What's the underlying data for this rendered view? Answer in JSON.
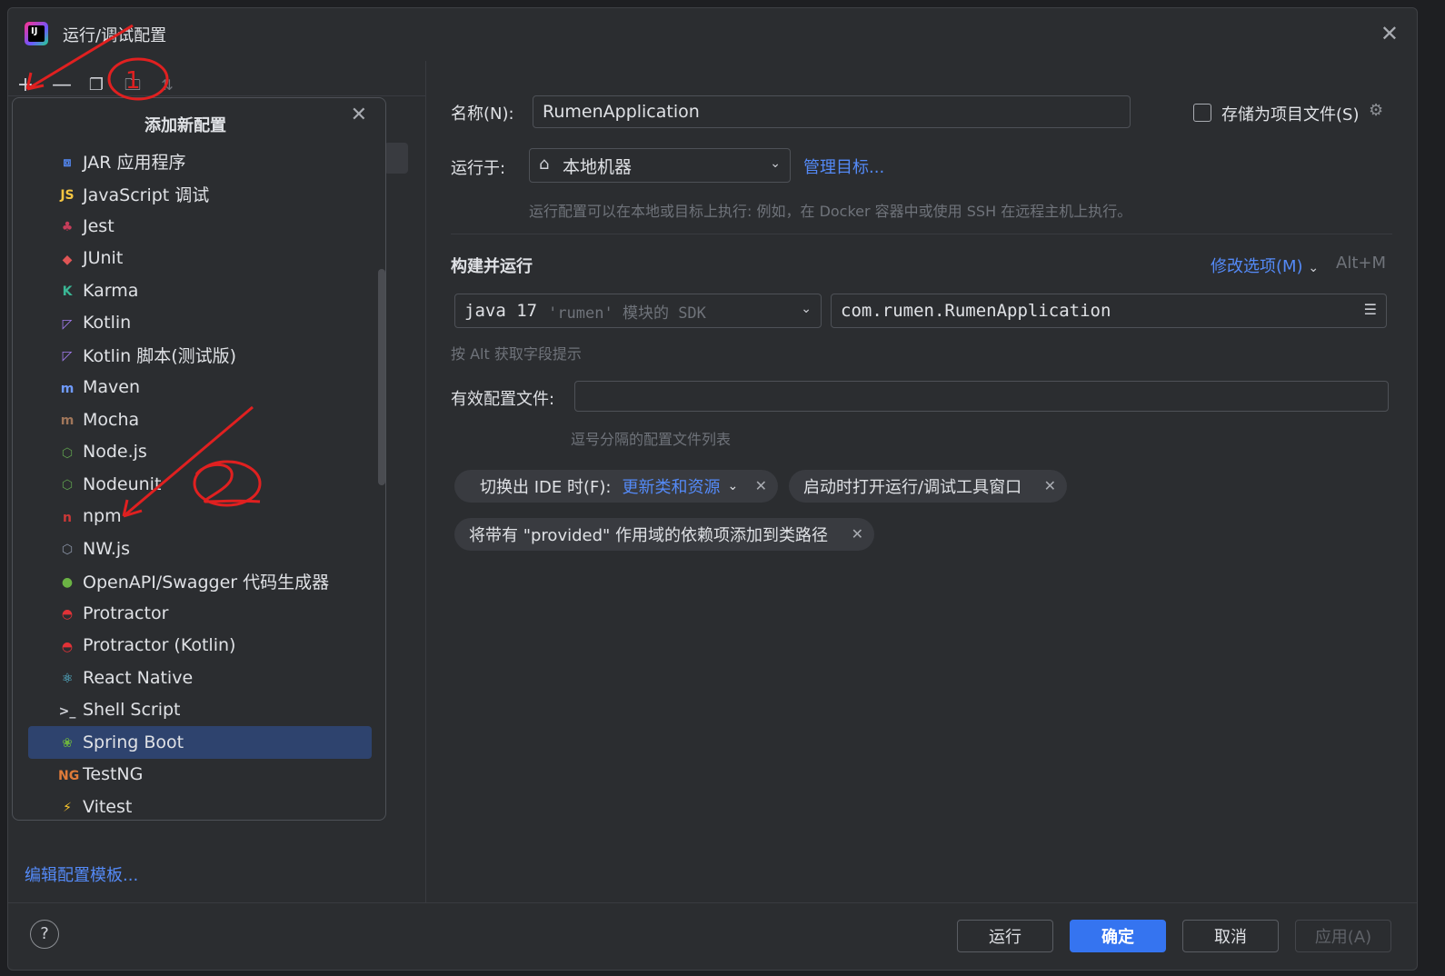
{
  "window": {
    "title": "运行/调试配置"
  },
  "toolbar": {
    "add": "+",
    "remove": "—"
  },
  "popup": {
    "title": "添加新配置",
    "items": [
      {
        "label": "JAR 应用程序",
        "icon": "jar-icon",
        "glyph": "⧈",
        "color": "#548af7"
      },
      {
        "label": "JavaScript 调试",
        "icon": "javascript-icon",
        "glyph": "JS",
        "color": "#f4c542"
      },
      {
        "label": "Jest",
        "icon": "jest-icon",
        "glyph": "♣",
        "color": "#c63d5a"
      },
      {
        "label": "JUnit",
        "icon": "junit-icon",
        "glyph": "◆",
        "color": "#e05555"
      },
      {
        "label": "Karma",
        "icon": "karma-icon",
        "glyph": "K",
        "color": "#3ab795"
      },
      {
        "label": "Kotlin",
        "icon": "kotlin-icon",
        "glyph": "◸",
        "color": "#a37cf0"
      },
      {
        "label": "Kotlin 脚本(测试版)",
        "icon": "kotlin-script-icon",
        "glyph": "◸",
        "color": "#a37cf0"
      },
      {
        "label": "Maven",
        "icon": "maven-icon",
        "glyph": "m",
        "color": "#6f9bff"
      },
      {
        "label": "Mocha",
        "icon": "mocha-icon",
        "glyph": "m",
        "color": "#a0765a"
      },
      {
        "label": "Node.js",
        "icon": "nodejs-icon",
        "glyph": "⬡",
        "color": "#5fa04e"
      },
      {
        "label": "Nodeunit",
        "icon": "nodeunit-icon",
        "glyph": "⬡",
        "color": "#5fa04e"
      },
      {
        "label": "npm",
        "icon": "npm-icon",
        "glyph": "n",
        "color": "#cb3837"
      },
      {
        "label": "NW.js",
        "icon": "nwjs-icon",
        "glyph": "⬡",
        "color": "#8c95a8"
      },
      {
        "label": "OpenAPI/Swagger 代码生成器",
        "icon": "openapi-icon",
        "glyph": "●",
        "color": "#6bb344"
      },
      {
        "label": "Protractor",
        "icon": "protractor-icon",
        "glyph": "◓",
        "color": "#e23237"
      },
      {
        "label": "Protractor (Kotlin)",
        "icon": "protractor-kotlin-icon",
        "glyph": "◓",
        "color": "#e23237"
      },
      {
        "label": "React Native",
        "icon": "react-icon",
        "glyph": "⚛",
        "color": "#61dafb"
      },
      {
        "label": "Shell Script",
        "icon": "shell-script-icon",
        "glyph": ">_",
        "color": "#ced0d6"
      },
      {
        "label": "Spring Boot",
        "icon": "spring-boot-icon",
        "glyph": "❀",
        "color": "#6db33f",
        "selected": true
      },
      {
        "label": "TestNG",
        "icon": "testng-icon",
        "glyph": "NG",
        "color": "#e07b39"
      },
      {
        "label": "Vitest",
        "icon": "vitest-icon",
        "glyph": "⚡",
        "color": "#fcc72b"
      }
    ]
  },
  "left": {
    "edit_templates": "编辑配置模板..."
  },
  "form": {
    "name_label": "名称(N):",
    "name_value": "RumenApplication",
    "store_label": "存储为项目文件(S)",
    "run_on_label": "运行于:",
    "run_on_value": "本地机器",
    "manage_targets": "管理目标...",
    "run_on_hint": "运行配置可以在本地或目标上执行: 例如，在 Docker 容器中或使用 SSH 在远程主机上执行。",
    "build_section": "构建并运行",
    "modify_options": "修改选项(M)",
    "modify_shortcut": "Alt+M",
    "jdk_value": "java 17",
    "jdk_hint": "'rumen' 模块的 SDK",
    "main_class": "com.rumen.RumenApplication",
    "alt_hint": "按 Alt 获取字段提示",
    "active_profiles_label": "有效配置文件:",
    "active_profiles_hint": "逗号分隔的配置文件列表",
    "chip1_label": "切换出 IDE 时(F):",
    "chip1_value": "更新类和资源",
    "chip2_label": "启动时打开运行/调试工具窗口",
    "chip3_label": "将带有 \"provided\" 作用域的依赖项添加到类路径"
  },
  "footer": {
    "help": "?",
    "run": "运行",
    "ok": "确定",
    "cancel": "取消",
    "apply": "应用(A)"
  },
  "annotations": {
    "one": "1",
    "two": "2"
  }
}
